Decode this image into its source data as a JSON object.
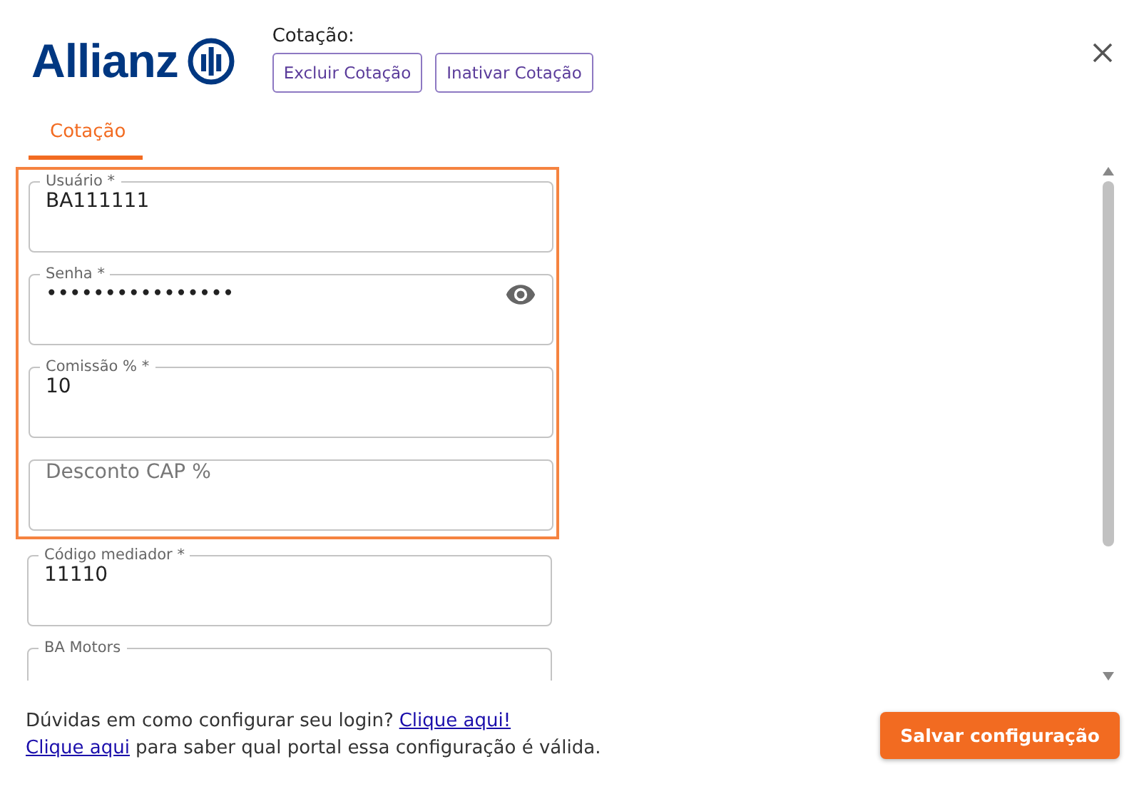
{
  "header": {
    "logo": "Allianz",
    "quote_label": "Cotação:",
    "buttons": [
      "Excluir Cotação",
      "Inativar Cotação"
    ]
  },
  "tabs": [
    {
      "label": "Cotação",
      "selected": true
    }
  ],
  "highlighted_fields": [
    {
      "kind": "text",
      "label": "Usuário *",
      "value": "BA111111"
    },
    {
      "kind": "password",
      "label": "Senha *",
      "value": "••••••••••••••••"
    },
    {
      "kind": "text",
      "label": "Comissão % *",
      "value": "10"
    },
    {
      "kind": "text",
      "placeholder": "Desconto CAP %"
    }
  ],
  "other_fields": [
    {
      "kind": "text",
      "label": "Código mediador *",
      "value": "11110"
    },
    {
      "kind": "text",
      "label": "BA Motors"
    }
  ],
  "footer": {
    "help_text": "Dúvidas em como configurar seu login?",
    "help_link": "Clique aqui!",
    "portal_link": "Clique aqui",
    "portal_text": "para saber qual portal essa configuração é válida.",
    "save_button": "Salvar configuração"
  }
}
